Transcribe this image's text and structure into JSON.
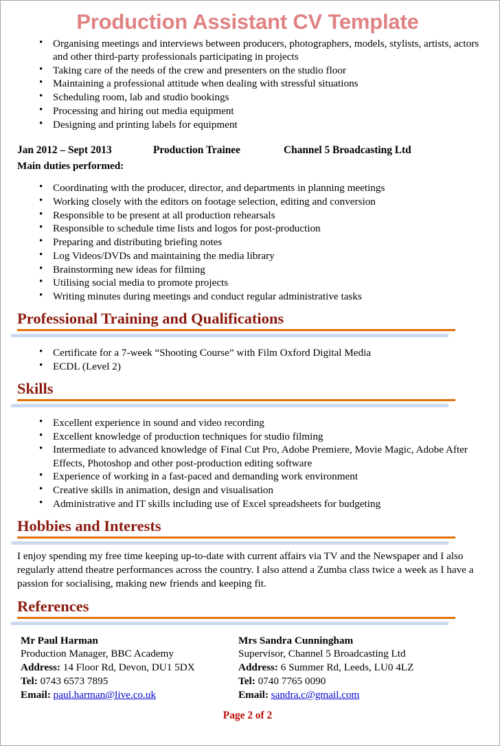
{
  "document": {
    "title": "Production Assistant CV Template",
    "page_footer": "Page 2 of 2"
  },
  "colors": {
    "title": "#E08283",
    "section_heading": "#8B1A0E",
    "rule_orange": "#E2700A",
    "rule_blue": "#CBDAF0",
    "footer": "#BB0A06",
    "link": "#0000CC"
  },
  "top_duties": [
    "Organising meetings and interviews between producers, photographers, models, stylists, artists, actors and other third-party professionals participating in projects",
    "Taking care of the needs of the crew and presenters on the studio floor",
    "Maintaining a professional attitude when dealing with stressful situations",
    "Scheduling room, lab and studio bookings",
    "Processing and hiring out media equipment",
    "Designing and printing labels for equipment"
  ],
  "employment": {
    "dates": "Jan 2012 – Sept 2013",
    "role": "Production Trainee",
    "company": "Channel 5 Broadcasting Ltd",
    "duties_label": "Main duties performed:",
    "duties": [
      "Coordinating with the producer, director, and departments in planning meetings",
      "Working closely with the editors on footage selection, editing and conversion",
      "Responsible to be present at all production rehearsals",
      "Responsible to schedule time lists and logos for post-production",
      "Preparing and distributing briefing notes",
      "Log Videos/DVDs and maintaining the media library",
      "Brainstorming new ideas for filming",
      "Utilising social media to promote projects",
      "Writing minutes during meetings and conduct regular administrative tasks"
    ]
  },
  "training": {
    "heading": "Professional Training and Qualifications",
    "items": [
      "Certificate for a 7-week “Shooting Course” with Film Oxford Digital Media",
      "ECDL (Level 2)"
    ]
  },
  "skills": {
    "heading": "Skills",
    "items": [
      "Excellent experience in sound and video recording",
      "Excellent knowledge of production techniques for studio filming",
      "Intermediate to advanced knowledge of Final Cut Pro, Adobe Premiere, Movie Magic, Adobe After Effects, Photoshop and other post-production editing software",
      "Experience of working in a fast-paced and demanding work environment",
      "Creative skills in animation, design and visualisation",
      "Administrative and IT skills including use of Excel spreadsheets for budgeting"
    ]
  },
  "hobbies": {
    "heading": "Hobbies and Interests",
    "text": "I enjoy spending my free time keeping up-to-date with current affairs via TV and the Newspaper and I also regularly attend theatre performances across the country. I also attend a Zumba class twice a week as I have a passion for socialising, making new friends and keeping fit."
  },
  "references": {
    "heading": "References",
    "labels": {
      "address": "Address:",
      "tel": "Tel:",
      "email": "Email:"
    },
    "entries": [
      {
        "name": "Mr Paul Harman",
        "position": "Production Manager, BBC Academy",
        "address": "14 Floor Rd, Devon, DU1 5DX",
        "tel": "0743 6573 7895",
        "email": "paul.harman@live.co.uk"
      },
      {
        "name": "Mrs Sandra Cunningham",
        "position": "Supervisor, Channel 5 Broadcasting Ltd",
        "address": "6 Summer Rd, Leeds, LU0 4LZ",
        "tel": "0740 7765 0090",
        "email": "sandra.c@gmail.com"
      }
    ]
  }
}
